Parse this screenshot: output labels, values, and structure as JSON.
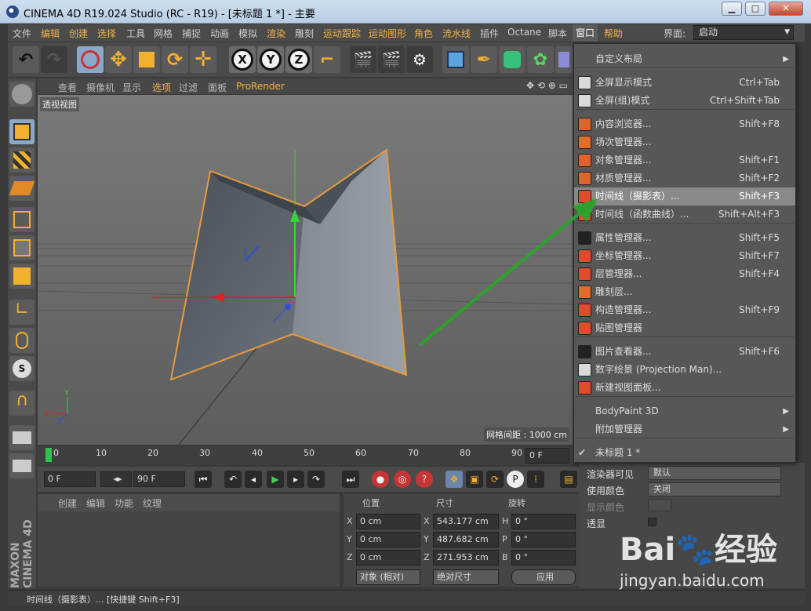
{
  "window": {
    "title": "CINEMA 4D R19.024 Studio (RC - R19) - [未标题 1 *] - 主要",
    "minimize": "▁",
    "maximize": "□",
    "close": "✕"
  },
  "menubar": {
    "items": [
      "文件",
      "编辑",
      "创建",
      "选择",
      "工具",
      "网格",
      "捕捉",
      "动画",
      "模拟",
      "渲染",
      "雕刻",
      "运动跟踪",
      "运动图形",
      "角色",
      "流水线",
      "插件",
      "Octane",
      "脚本",
      "窗口",
      "帮助"
    ],
    "layout_label": "界面:",
    "layout_value": "启动"
  },
  "toolbar": {
    "axis_x": "X",
    "axis_y": "Y",
    "axis_z": "Z"
  },
  "viewport": {
    "menu": [
      "查看",
      "摄像机",
      "显示",
      "选项",
      "过滤",
      "面板",
      "ProRender"
    ],
    "label": "透视视图",
    "grid_spacing": "网格间距 : 1000 cm",
    "axis_x": "X",
    "axis_y": "Y",
    "axis_z": "Z"
  },
  "timeline": {
    "ticks": [
      "0",
      "10",
      "20",
      "30",
      "40",
      "50",
      "60",
      "70",
      "80",
      "90"
    ],
    "current_frame": "0 F",
    "start_frame": "0 F",
    "end_frame": "90 F"
  },
  "materials": {
    "menu": [
      "创建",
      "编辑",
      "功能",
      "纹理"
    ]
  },
  "coordinates": {
    "headers": [
      "位置",
      "尺寸",
      "旋转"
    ],
    "rows": [
      {
        "axis": "X",
        "pos": "0 cm",
        "size_axis": "X",
        "size": "543.177 cm",
        "rot_axis": "H",
        "rot": "0 °"
      },
      {
        "axis": "Y",
        "pos": "0 cm",
        "size_axis": "Y",
        "size": "487.682 cm",
        "rot_axis": "P",
        "rot": "0 °"
      },
      {
        "axis": "Z",
        "pos": "0 cm",
        "size_axis": "Z",
        "size": "271.953 cm",
        "rot_axis": "B",
        "rot": "0 °"
      }
    ],
    "mode": "对象 (相对)",
    "size_mode": "绝对尺寸",
    "apply": "应用"
  },
  "attributes": {
    "renderer_visible_label": "渲染器可见",
    "renderer_visible_value": "默认",
    "use_color_label": "使用颜色",
    "use_color_value": "关闭",
    "display_color_label": "显示颜色",
    "xray_label": "透显"
  },
  "window_menu": {
    "items": [
      {
        "label": "自定义布局",
        "shortcut": "",
        "submenu": true,
        "icon_color": ""
      },
      {
        "label": "全屏显示模式",
        "shortcut": "Ctrl+Tab",
        "submenu": false,
        "icon_color": "#d9d9d9"
      },
      {
        "label": "全屏(组)模式",
        "shortcut": "Ctrl+Shift+Tab",
        "submenu": false,
        "icon_color": "#d9d9d9"
      },
      {
        "label": "内容浏览器...",
        "shortcut": "Shift+F8",
        "submenu": false,
        "icon_color": "#e0622d"
      },
      {
        "label": "场次管理器...",
        "shortcut": "",
        "submenu": false,
        "icon_color": "#e56b2a"
      },
      {
        "label": "对象管理器...",
        "shortcut": "Shift+F1",
        "submenu": false,
        "icon_color": "#e0622d"
      },
      {
        "label": "材质管理器...",
        "shortcut": "Shift+F2",
        "submenu": false,
        "icon_color": "#e0622d"
      },
      {
        "label": "时间线（摄影表）...",
        "shortcut": "Shift+F3",
        "submenu": false,
        "icon_color": "#e04a2d",
        "highlighted": true
      },
      {
        "label": "时间线（函数曲线）...",
        "shortcut": "Shift+Alt+F3",
        "submenu": false,
        "icon_color": "#e04a2d"
      },
      {
        "label": "属性管理器...",
        "shortcut": "Shift+F5",
        "submenu": false,
        "icon_color": "#222222"
      },
      {
        "label": "坐标管理器...",
        "shortcut": "Shift+F7",
        "submenu": false,
        "icon_color": "#e04a2d"
      },
      {
        "label": "层管理器...",
        "shortcut": "Shift+F4",
        "submenu": false,
        "icon_color": "#e04a2d"
      },
      {
        "label": "雕刻层...",
        "shortcut": "",
        "submenu": false,
        "icon_color": "#e56b2a"
      },
      {
        "label": "构造管理器...",
        "shortcut": "Shift+F9",
        "submenu": false,
        "icon_color": "#e04a2d"
      },
      {
        "label": "贴图管理器",
        "shortcut": "",
        "submenu": false,
        "icon_color": "#e04a2d"
      },
      {
        "label": "图片查看器...",
        "shortcut": "Shift+F6",
        "submenu": false,
        "icon_color": "#222222"
      },
      {
        "label": "数字绘景 (Projection Man)...",
        "shortcut": "",
        "submenu": false,
        "icon_color": "#d9d9d9"
      },
      {
        "label": "新建视图面板...",
        "shortcut": "",
        "submenu": false,
        "icon_color": "#e04a2d"
      },
      {
        "label": "BodyPaint 3D",
        "shortcut": "",
        "submenu": true,
        "icon_color": ""
      },
      {
        "label": "附加管理器",
        "shortcut": "",
        "submenu": true,
        "icon_color": ""
      },
      {
        "label": "未标题 1 *",
        "shortcut": "",
        "submenu": false,
        "icon_color": "",
        "checked": true
      }
    ]
  },
  "statusbar": {
    "text": "时间线（摄影表）... [快捷键 Shift+F3]"
  },
  "watermark": {
    "brand_a": "Bai",
    "brand_b": "经验",
    "url": "jingyan.baidu.com"
  },
  "colors": {
    "accent": "#f4b244",
    "menu_highlight": "#898989",
    "selection_orange": "#e89a3c"
  }
}
